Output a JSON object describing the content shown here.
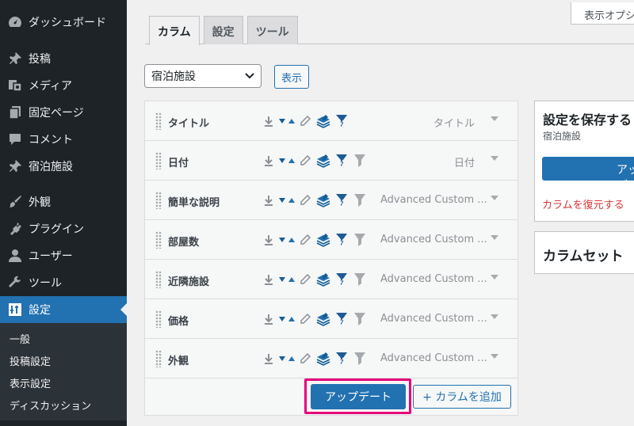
{
  "sidebar": {
    "items": [
      {
        "label": "ダッシュボード",
        "icon": "dashboard-icon"
      },
      {
        "label": "投稿",
        "icon": "pin-icon"
      },
      {
        "label": "メディア",
        "icon": "media-icon"
      },
      {
        "label": "固定ページ",
        "icon": "page-icon"
      },
      {
        "label": "コメント",
        "icon": "comment-icon"
      },
      {
        "label": "宿泊施設",
        "icon": "pin-icon"
      },
      {
        "label": "外観",
        "icon": "brush-icon"
      },
      {
        "label": "プラグイン",
        "icon": "plugin-icon"
      },
      {
        "label": "ユーザー",
        "icon": "user-icon"
      },
      {
        "label": "ツール",
        "icon": "wrench-icon"
      },
      {
        "label": "設定",
        "icon": "settings-icon"
      }
    ],
    "submenu": [
      "一般",
      "投稿設定",
      "表示設定",
      "ディスカッション"
    ]
  },
  "screen_options": "表示オプション",
  "tabs": [
    "カラム",
    "設定",
    "ツール"
  ],
  "post_type_select": {
    "value": "宿泊施設"
  },
  "show_button": "表示",
  "columns": [
    {
      "name": "タイトル",
      "type": "タイトル"
    },
    {
      "name": "日付",
      "type": "日付"
    },
    {
      "name": "簡単な説明",
      "type": "Advanced Custom ..."
    },
    {
      "name": "部屋数",
      "type": "Advanced Custom ..."
    },
    {
      "name": "近隣施設",
      "type": "Advanced Custom ..."
    },
    {
      "name": "価格",
      "type": "Advanced Custom ..."
    },
    {
      "name": "外観",
      "type": "Advanced Custom ..."
    }
  ],
  "update_button": "アップデート",
  "add_column_button": "+ カラムを追加",
  "save_panel": {
    "title": "設定を保存する",
    "subtitle": "宿泊施設",
    "button": "アップデート",
    "restore_link": "カラムを復元する"
  },
  "column_sets_panel": {
    "title": "カラムセット"
  },
  "colors": {
    "primary": "#2271b1",
    "sidebar": "#1d2327",
    "highlight": "#e6007a",
    "danger": "#d63638"
  }
}
